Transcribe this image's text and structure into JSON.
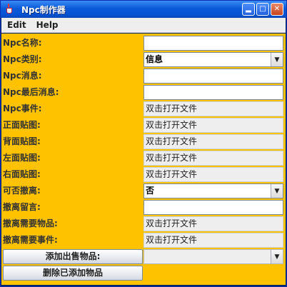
{
  "window": {
    "title": "Npc制作器"
  },
  "menu": {
    "items": [
      "Edit",
      "Help"
    ]
  },
  "form": {
    "npc_name_label": "Npc名称:",
    "npc_type_label": "Npc类别:",
    "npc_type_value": "信息",
    "npc_message_label": "Npc消息:",
    "npc_last_message_label": "Npc最后消息:",
    "npc_event_label": "Npc事件:",
    "npc_event_value": "双击打开文件",
    "front_image_label": "正面贴图:",
    "front_image_value": "双击打开文件",
    "back_image_label": "背面贴图:",
    "back_image_value": "双击打开文件",
    "left_image_label": "左面贴图:",
    "left_image_value": "双击打开文件",
    "right_image_label": "右面贴图:",
    "right_image_value": "双击打开文件",
    "withdraw_label": "可否撤离:",
    "withdraw_value": "否",
    "withdraw_message_label": "撤离留言:",
    "withdraw_items_label": "撤离需要物品:",
    "withdraw_items_value": "双击打开文件",
    "withdraw_events_label": "撤离需要事件:",
    "withdraw_events_value": "双击打开文件",
    "add_sale_button": "添加出售物品:",
    "delete_added_button": "删除已添加物品",
    "sale_items_value": ""
  },
  "icons": {
    "app": "java-cup-icon",
    "minimize": "minimize-icon",
    "maximize": "maximize-icon",
    "close": "close-icon",
    "dropdown": "chevron-down-icon"
  },
  "colors": {
    "form_background": "#ffc200",
    "title_bar": "#0653d4"
  }
}
